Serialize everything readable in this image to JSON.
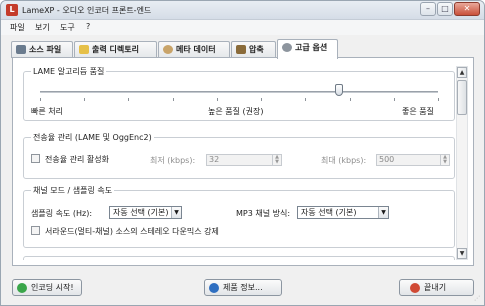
{
  "window": {
    "title": "LameXP - 오디오 인코더 프론트-엔드",
    "controls": [
      "–",
      "□",
      "✕"
    ]
  },
  "menu": [
    "파일",
    "보기",
    "도구",
    "?"
  ],
  "tabs": [
    {
      "label": "소스 파일",
      "icon": "files-icon"
    },
    {
      "label": "출력 디렉토리",
      "icon": "folder-icon"
    },
    {
      "label": "메타 데이터",
      "icon": "metadata-disc-icon"
    },
    {
      "label": "압축",
      "icon": "compression-icon"
    },
    {
      "label": "고급 옵션",
      "icon": "gear-icon",
      "active": true
    }
  ],
  "lame_quality": {
    "title": "LAME 알고리듬 품질",
    "labels": {
      "left": "빠른 처리",
      "center": "높은 품질 (권장)",
      "right": "좋은 품질"
    },
    "level_fraction": 0.75
  },
  "bitrate_mgmt": {
    "title": "전송율 관리 (LAME 및 OggEnc2)",
    "enable_label": "전송율 관리 활성화",
    "min_label": "최저 (kbps):",
    "min_value": "32",
    "max_label": "최대 (kbps):",
    "max_value": "500"
  },
  "channel_mode": {
    "title": "채널 모드 / 샘플링 속도",
    "sample_rate_label": "샘플링 속도 (Hz):",
    "sample_rate_value": "자동 선택 (기본)",
    "mp3_channel_label": "MP3 채널 방식:",
    "mp3_channel_value": "자동 선택 (기본)",
    "downmix_label": "서라운드(멀티-채널) 소스의 스테레오 다운믹스 강제"
  },
  "buttons": {
    "encode": "인코딩 시작!",
    "product_info": "제품 정보...",
    "quit": "끝내기"
  },
  "colors": {
    "accent_orange": "#e9a33c",
    "encode_green": "#3aa64a",
    "info_blue": "#2f6fc1",
    "quit_red": "#d04a35"
  }
}
